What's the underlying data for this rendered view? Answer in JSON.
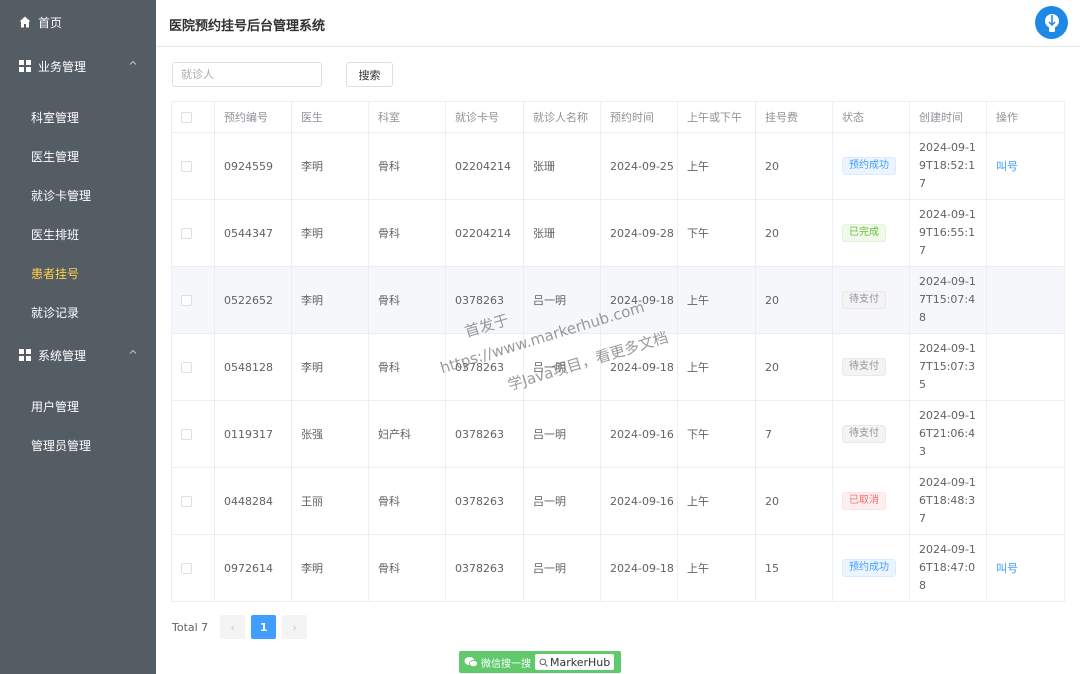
{
  "sidebar": {
    "home": "首页",
    "group1": "业务管理",
    "group1_items": [
      "科室管理",
      "医生管理",
      "就诊卡管理",
      "医生排班",
      "患者挂号",
      "就诊记录"
    ],
    "group2": "系统管理",
    "group2_items": [
      "用户管理",
      "管理员管理"
    ],
    "active_item": "患者挂号",
    "active_color": "#ffd04b"
  },
  "header": {
    "title": "医院预约挂号后台管理系统"
  },
  "search": {
    "placeholder": "就诊人",
    "button": "搜索"
  },
  "table": {
    "columns": [
      "预约编号",
      "医生",
      "科室",
      "就诊卡号",
      "就诊人名称",
      "预约时间",
      "上午或下午",
      "挂号费",
      "状态",
      "创建时间",
      "操作"
    ],
    "rows": [
      {
        "id": "0924559",
        "doctor": "李明",
        "dept": "骨科",
        "card": "02204214",
        "patient": "张珊",
        "date": "2024-09-25",
        "period": "上午",
        "fee": "20",
        "status": "预约成功",
        "created": "2024-09-19T18:52:17",
        "action": "叫号"
      },
      {
        "id": "0544347",
        "doctor": "李明",
        "dept": "骨科",
        "card": "02204214",
        "patient": "张珊",
        "date": "2024-09-28",
        "period": "下午",
        "fee": "20",
        "status": "已完成",
        "created": "2024-09-19T16:55:17",
        "action": ""
      },
      {
        "id": "0522652",
        "doctor": "李明",
        "dept": "骨科",
        "card": "0378263",
        "patient": "吕一明",
        "date": "2024-09-18",
        "period": "上午",
        "fee": "20",
        "status": "待支付",
        "created": "2024-09-17T15:07:48",
        "action": ""
      },
      {
        "id": "0548128",
        "doctor": "李明",
        "dept": "骨科",
        "card": "0378263",
        "patient": "吕一明",
        "date": "2024-09-18",
        "period": "上午",
        "fee": "20",
        "status": "待支付",
        "created": "2024-09-17T15:07:35",
        "action": ""
      },
      {
        "id": "0119317",
        "doctor": "张强",
        "dept": "妇产科",
        "card": "0378263",
        "patient": "吕一明",
        "date": "2024-09-16",
        "period": "下午",
        "fee": "7",
        "status": "待支付",
        "created": "2024-09-16T21:06:43",
        "action": ""
      },
      {
        "id": "0448284",
        "doctor": "王丽",
        "dept": "骨科",
        "card": "0378263",
        "patient": "吕一明",
        "date": "2024-09-16",
        "period": "上午",
        "fee": "20",
        "status": "已取消",
        "created": "2024-09-16T18:48:37",
        "action": ""
      },
      {
        "id": "0972614",
        "doctor": "李明",
        "dept": "骨科",
        "card": "0378263",
        "patient": "吕一明",
        "date": "2024-09-18",
        "period": "上午",
        "fee": "15",
        "status": "预约成功",
        "created": "2024-09-16T18:47:08",
        "action": "叫号"
      }
    ],
    "highlighted_row": 2
  },
  "pagination": {
    "total": "Total 7",
    "prev": "‹",
    "current": "1",
    "next": "›"
  },
  "watermark": {
    "line1": "首发于",
    "line2": "https://www.markerhub.com",
    "line3": "学Java项目，看更多文档"
  },
  "badge": {
    "left": "微信搜一搜",
    "right": "MarkerHub"
  },
  "colors": {
    "sidebar_bg": "#545c64",
    "primary": "#409eff"
  }
}
